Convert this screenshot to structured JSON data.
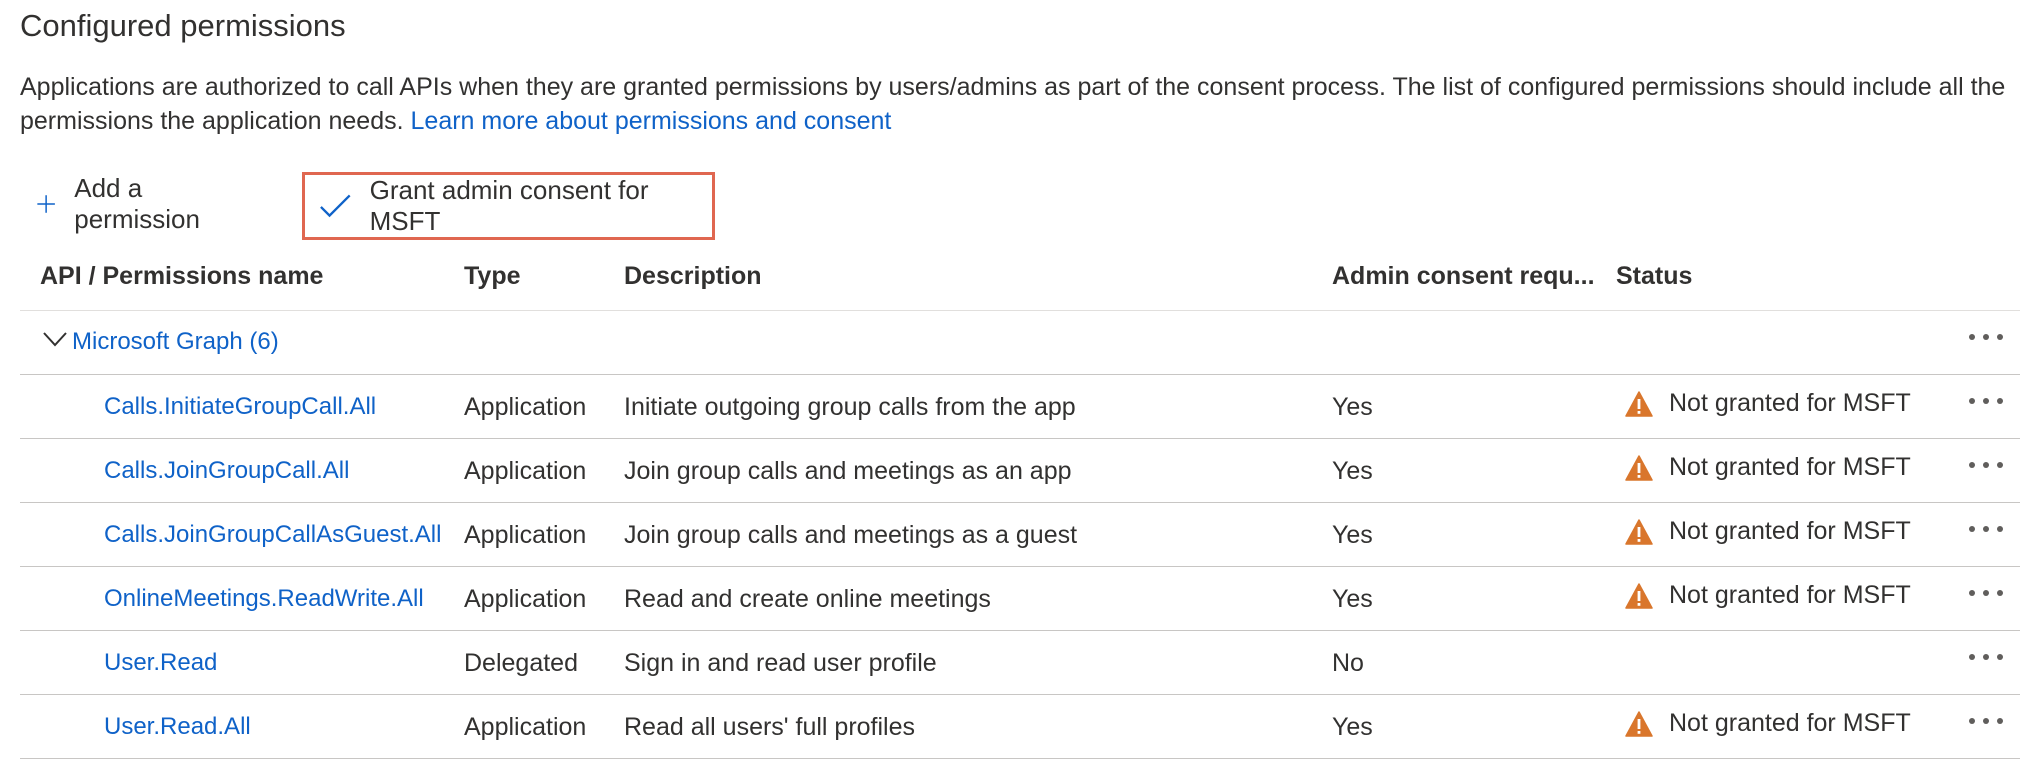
{
  "page": {
    "title": "Configured permissions",
    "description": "Applications are authorized to call APIs when they are granted permissions by users/admins as part of the consent process. The list of configured permissions should include all the permissions the application needs.",
    "learn_more_link": "Learn more about permissions and consent"
  },
  "toolbar": {
    "add_label": "Add a permission",
    "grant_label": "Grant admin consent for MSFT"
  },
  "table": {
    "headers": {
      "name": "API / Permissions name",
      "type": "Type",
      "description": "Description",
      "admin": "Admin consent requ...",
      "status": "Status"
    },
    "group": {
      "label": "Microsoft Graph (6)"
    },
    "rows": [
      {
        "name": "Calls.InitiateGroupCall.All",
        "type": "Application",
        "description": "Initiate outgoing group calls from the app",
        "admin": "Yes",
        "status": "Not granted for MSFT"
      },
      {
        "name": "Calls.JoinGroupCall.All",
        "type": "Application",
        "description": "Join group calls and meetings as an app",
        "admin": "Yes",
        "status": "Not granted for MSFT"
      },
      {
        "name": "Calls.JoinGroupCallAsGuest.All",
        "type": "Application",
        "description": "Join group calls and meetings as a guest",
        "admin": "Yes",
        "status": "Not granted for MSFT"
      },
      {
        "name": "OnlineMeetings.ReadWrite.All",
        "type": "Application",
        "description": "Read and create online meetings",
        "admin": "Yes",
        "status": "Not granted for MSFT"
      },
      {
        "name": "User.Read",
        "type": "Delegated",
        "description": "Sign in and read user profile",
        "admin": "No",
        "status": ""
      },
      {
        "name": "User.Read.All",
        "type": "Application",
        "description": "Read all users' full profiles",
        "admin": "Yes",
        "status": "Not granted for MSFT"
      }
    ]
  },
  "colors": {
    "link": "#0f62c8",
    "warning": "#d9762c",
    "highlight_border": "#e06750"
  }
}
